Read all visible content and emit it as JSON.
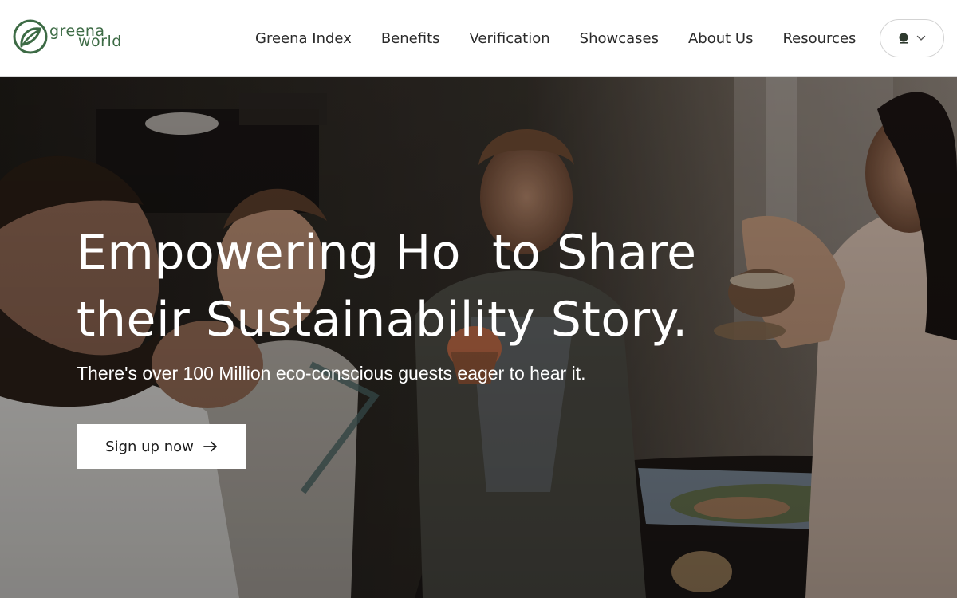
{
  "brand": {
    "name_line1": "greena",
    "name_line2": "world",
    "color": "#3d6b45"
  },
  "nav": {
    "items": [
      {
        "label": "Greena Index"
      },
      {
        "label": "Benefits"
      },
      {
        "label": "Verification"
      },
      {
        "label": "Showcases"
      },
      {
        "label": "About Us"
      },
      {
        "label": "Resources"
      }
    ]
  },
  "language_switcher": {
    "icon": "leaf-dot-icon",
    "chevron": "chevron-down-icon"
  },
  "hero": {
    "title_line1": "Empowering Ho  to Share",
    "title_line2": "their Sustainability Story.",
    "subtitle": "There's over 100 Million eco-conscious guests eager to hear it.",
    "cta_label": "Sign up now",
    "cta_icon": "arrow-right-icon"
  }
}
